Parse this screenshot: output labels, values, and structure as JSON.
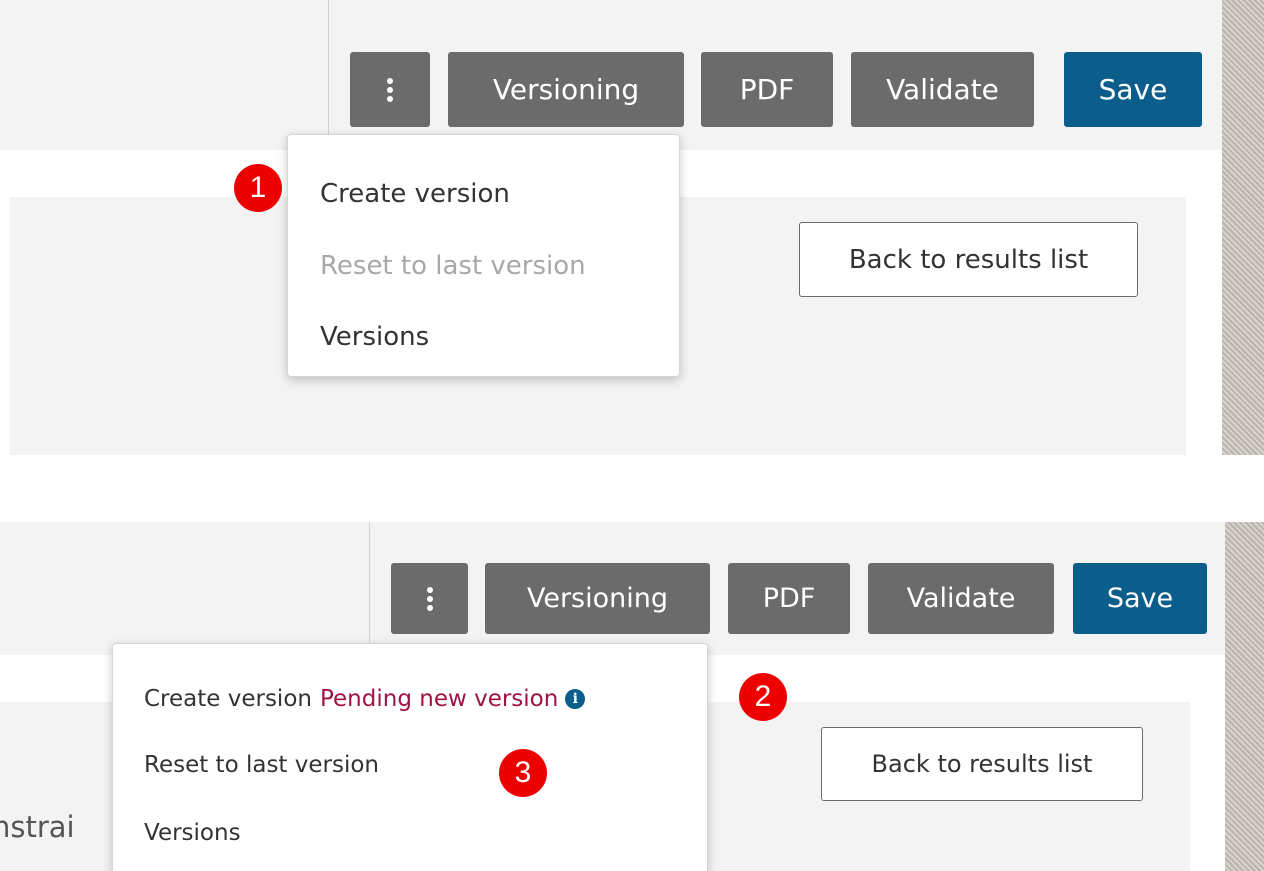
{
  "colors": {
    "button_gray": "#6b6b6b",
    "save_blue": "#0b5e8c",
    "pending_text": "#a01246",
    "badge_red": "#ee0000"
  },
  "panel_top": {
    "toolbar": {
      "more_icon": "kebab-vertical-icon",
      "versioning_label": "Versioning",
      "pdf_label": "PDF",
      "validate_label": "Validate",
      "save_label": "Save"
    },
    "back_button_label": "Back to results list",
    "menu": {
      "create_version": "Create version",
      "reset_last_version": "Reset to last version",
      "versions": "Versions"
    },
    "badge": "1"
  },
  "panel_bottom": {
    "toolbar": {
      "more_icon": "kebab-vertical-icon",
      "versioning_label": "Versioning",
      "pdf_label": "PDF",
      "validate_label": "Validate",
      "save_label": "Save"
    },
    "back_button_label": "Back to results list",
    "menu": {
      "create_version": "Create version",
      "pending_status": "Pending new version",
      "info_icon": "info-circle-icon",
      "info_glyph": "i",
      "reset_last_version": "Reset to last version",
      "versions": "Versions"
    },
    "partial_text": "nstrai",
    "badges": [
      "2",
      "3"
    ]
  }
}
